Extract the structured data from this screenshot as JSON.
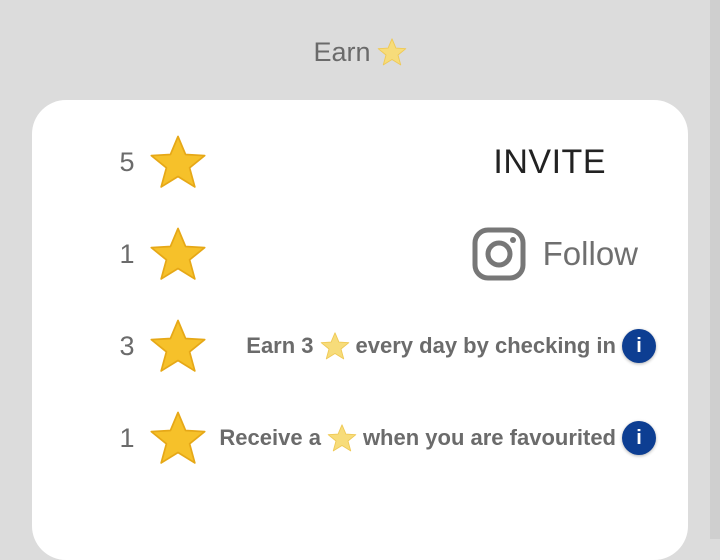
{
  "header": {
    "label": "Earn",
    "icon": "star-icon"
  },
  "rewards": [
    {
      "count": "5",
      "action": {
        "type": "button",
        "label": "INVITE"
      }
    },
    {
      "count": "1",
      "action": {
        "type": "follow",
        "label": "Follow",
        "icon": "instagram-icon"
      }
    },
    {
      "count": "3",
      "action": {
        "type": "info",
        "text_before": "Earn 3",
        "text_after": "every day by checking in",
        "info": "i"
      }
    },
    {
      "count": "1",
      "action": {
        "type": "info",
        "text_before": "Receive a",
        "text_after": "when you are favourited",
        "info": "i"
      }
    }
  ],
  "colors": {
    "background": "#dcdcdc",
    "card": "#ffffff",
    "star": "#f6c12a",
    "info_badge": "#0d3e92",
    "text_gray": "#6b6b6b"
  }
}
